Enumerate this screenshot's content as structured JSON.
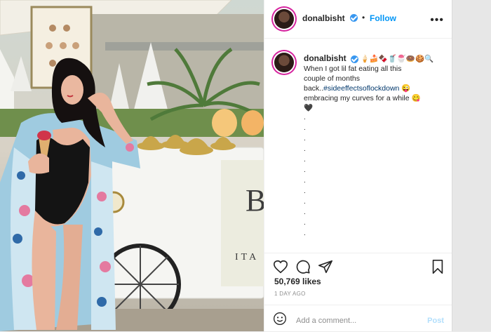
{
  "post": {
    "username": "donalbisht",
    "follow_label": "Follow",
    "caption_lines": [
      "When I got lil fat eating all this",
      "couple of months",
      "back..",
      "embracing my curves for a while"
    ],
    "hashtag": "#sideeffectsoflockdown",
    "likes": "50,769 likes",
    "timestamp": "1 DAY AGO",
    "comment_placeholder": "Add a comment...",
    "post_label": "Post",
    "photo_sign_text": "BIANCO",
    "cart_letters": "B",
    "cart_small_text": "ITA"
  },
  "colors": {
    "accent": "#0095f6",
    "hashtag": "#00376b",
    "muted": "#8e8e8e"
  },
  "icons": [
    "verified-badge-icon",
    "more-options-icon",
    "heart-icon",
    "comment-icon",
    "share-icon",
    "bookmark-icon",
    "emoji-icon"
  ]
}
